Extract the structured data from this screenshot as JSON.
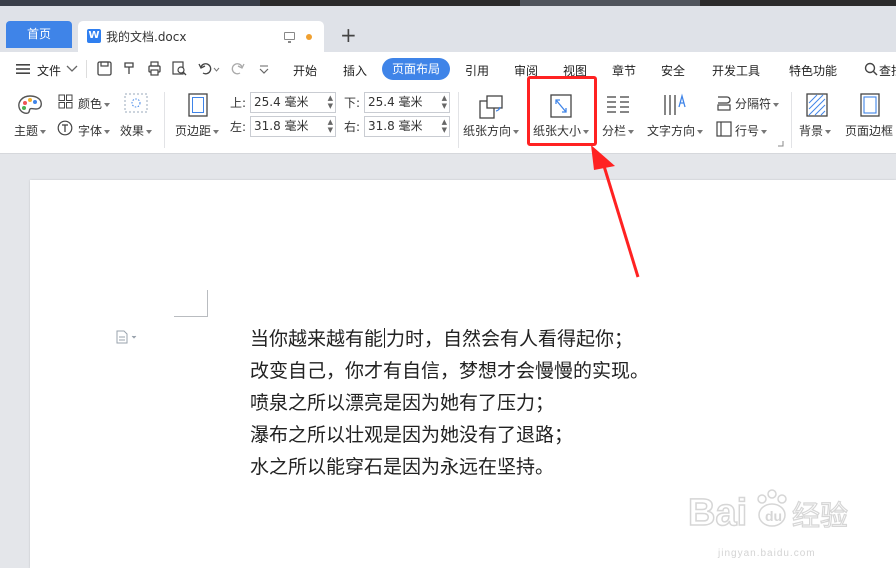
{
  "tabs": {
    "home_label": "首页",
    "doc_label": "我的文档.docx",
    "doc_icon": "W"
  },
  "menu": {
    "file_label": "文件",
    "items": [
      "开始",
      "插入",
      "页面布局",
      "引用",
      "审阅",
      "视图",
      "章节",
      "安全",
      "开发工具",
      "特色功能"
    ],
    "search_label": "查找"
  },
  "ribbon": {
    "theme_label": "主题",
    "color_label": "颜色",
    "font_label": "字体",
    "effect_label": "效果",
    "margin_label": "页边距",
    "top_label": "上:",
    "top_value": "25.4 毫米",
    "bottom_label": "下:",
    "bottom_value": "25.4 毫米",
    "left_label": "左:",
    "left_value": "31.8 毫米",
    "right_label": "右:",
    "right_value": "31.8 毫米",
    "orientation_label": "纸张方向",
    "size_label": "纸张大小",
    "columns_label": "分栏",
    "text_direction_label": "文字方向",
    "separator_label": "分隔符",
    "line_number_label": "行号",
    "background_label": "背景",
    "page_border_label": "页面边框"
  },
  "document": {
    "lines": [
      {
        "before": "当你越来越有能",
        "after": "力时，自然会有人看得起你；"
      },
      {
        "before": "改变自己，你才有自信，梦想才会慢慢的实现。",
        "after": ""
      },
      {
        "before": "喷泉之所以漂亮是因为她有了压力；",
        "after": ""
      },
      {
        "before": "瀑布之所以壮观是因为她没有了退路；",
        "after": ""
      },
      {
        "before": "水之所以能穿石是因为永远在坚持。",
        "after": ""
      }
    ]
  },
  "watermark": {
    "brand": "Bai du 经验",
    "url": "jingyan.baidu.com"
  },
  "colors": {
    "accent": "#3f84e8",
    "highlight": "#ff2222"
  }
}
